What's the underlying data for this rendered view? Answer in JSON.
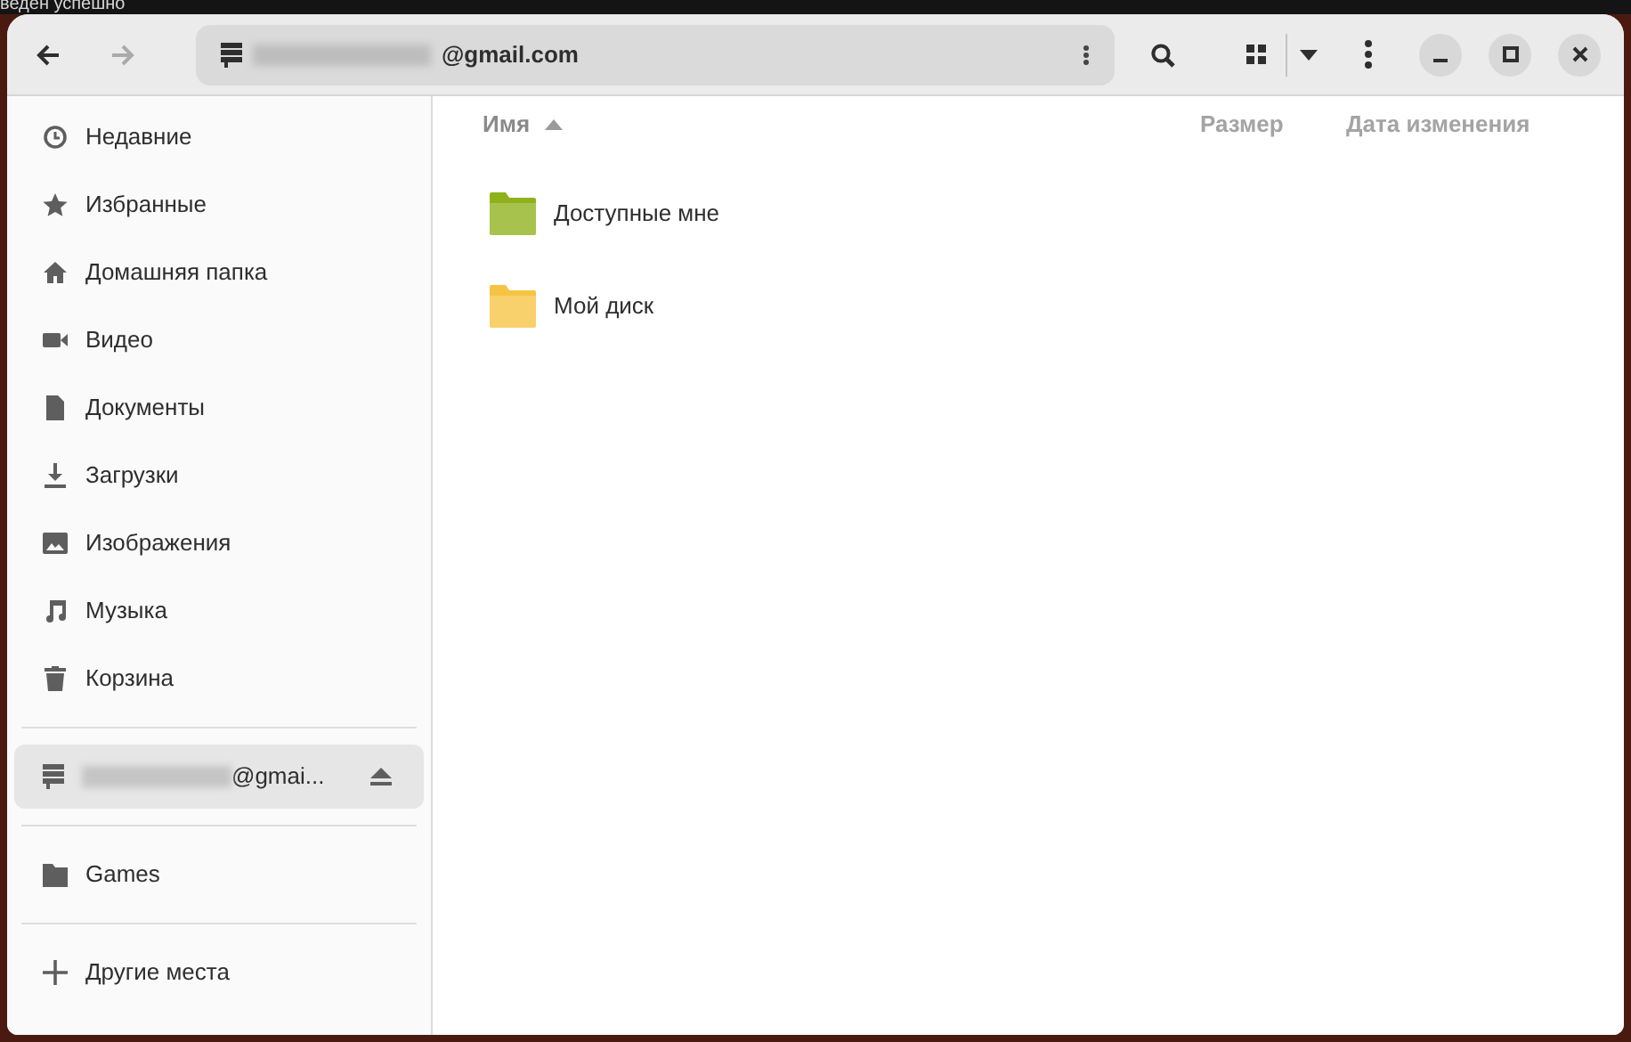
{
  "desktop_notice": "веден успешно",
  "header": {
    "path": "@gmail.com"
  },
  "sidebar": {
    "places": [
      {
        "label": "Недавние",
        "kind": "recent",
        "selected": false
      },
      {
        "label": "Избранные",
        "kind": "starred",
        "selected": false
      },
      {
        "label": "Домашняя папка",
        "kind": "home",
        "selected": false
      },
      {
        "label": "Видео",
        "kind": "video",
        "selected": false
      },
      {
        "label": "Документы",
        "kind": "document",
        "selected": false
      },
      {
        "label": "Загрузки",
        "kind": "download",
        "selected": false
      },
      {
        "label": "Изображения",
        "kind": "image",
        "selected": false
      },
      {
        "label": "Музыка",
        "kind": "music",
        "selected": false
      },
      {
        "label": "Корзина",
        "kind": "trash",
        "selected": false
      }
    ],
    "mounts": [
      {
        "label": "@gmai...",
        "selected": true
      }
    ],
    "bookmarks": [
      {
        "label": "Games",
        "selected": false
      }
    ],
    "other": {
      "label": "Другие места"
    }
  },
  "table": {
    "columns": [
      {
        "label": "Имя",
        "sorted": true
      },
      {
        "label": "Размер",
        "sorted": false
      },
      {
        "label": "Дата изменения",
        "sorted": false
      }
    ],
    "rows": [
      {
        "name": "Доступные мне",
        "color": "#8fb21c"
      },
      {
        "name": "Мой диск",
        "color": "#f6c343"
      }
    ]
  }
}
